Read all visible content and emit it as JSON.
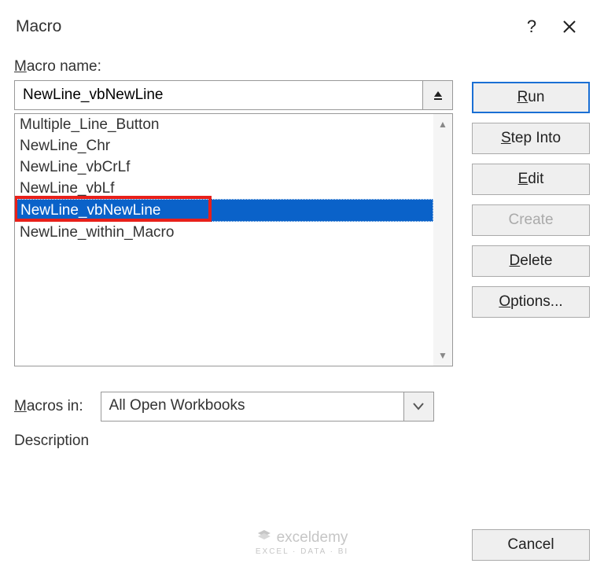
{
  "dialog": {
    "title": "Macro",
    "help_tooltip": "?",
    "close_tooltip": "Close"
  },
  "labels": {
    "macro_name_prefix": "M",
    "macro_name_rest": "acro name:",
    "macros_in_prefix": "M",
    "macros_in_rest": "acros in:",
    "description": "Description"
  },
  "macro_name": {
    "value": "NewLine_vbNewLine"
  },
  "macro_list": {
    "items": [
      {
        "label": "Multiple_Line_Button",
        "selected": false
      },
      {
        "label": "NewLine_Chr",
        "selected": false
      },
      {
        "label": "NewLine_vbCrLf",
        "selected": false
      },
      {
        "label": "NewLine_vbLf",
        "selected": false
      },
      {
        "label": "NewLine_vbNewLine",
        "selected": true
      },
      {
        "label": "NewLine_within_Macro",
        "selected": false
      }
    ]
  },
  "macros_in": {
    "value": "All Open Workbooks"
  },
  "buttons": {
    "run_u": "R",
    "run_rest": "un",
    "step_u": "S",
    "step_rest": "tep Into",
    "edit_u": "E",
    "edit_rest": "dit",
    "create": "Create",
    "delete_u": "D",
    "delete_rest": "elete",
    "options_u": "O",
    "options_rest": "ptions...",
    "cancel": "Cancel"
  },
  "watermark": {
    "brand": "exceldemy",
    "sub": "EXCEL · DATA · BI"
  }
}
